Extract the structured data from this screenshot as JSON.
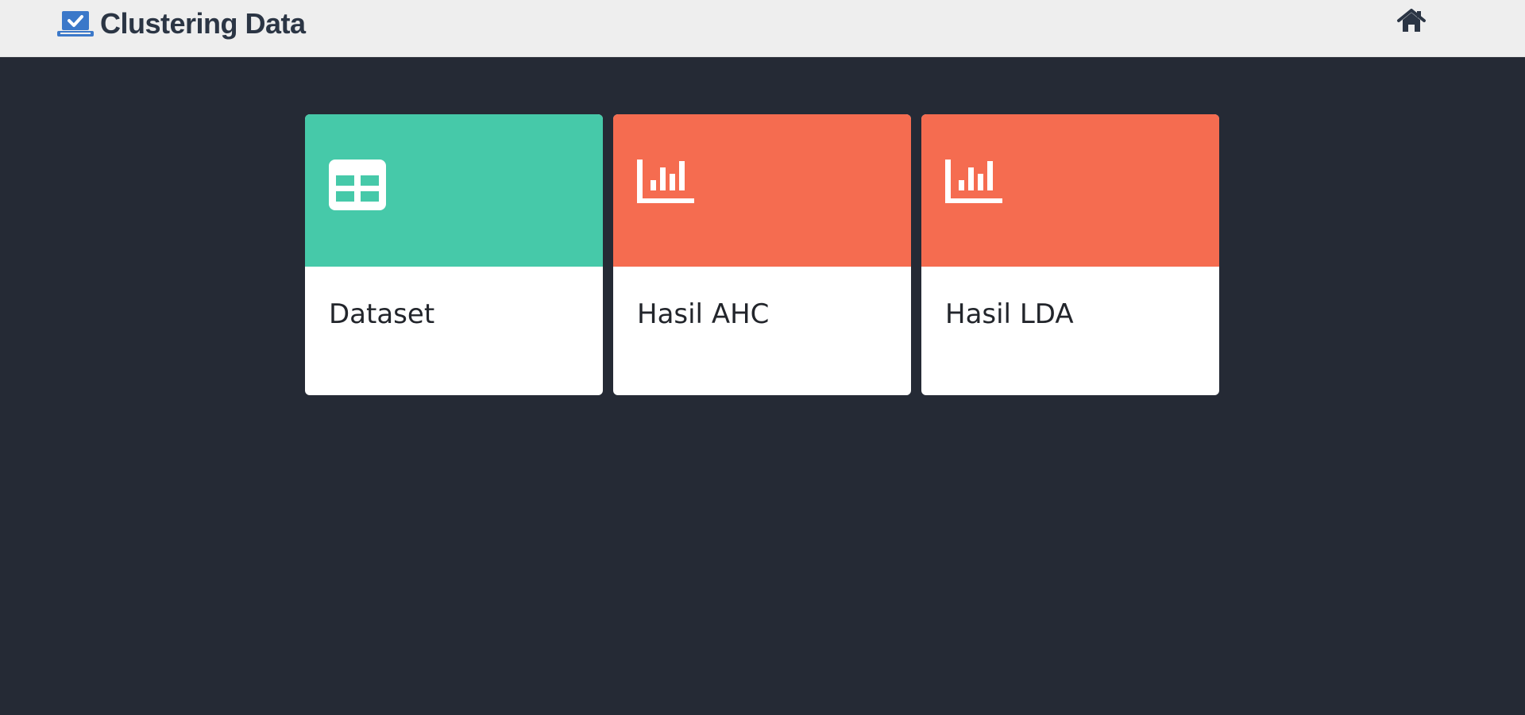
{
  "navbar": {
    "brand_title": "Clustering Data",
    "brand_icon": "laptop-check-icon",
    "home_icon": "home-icon"
  },
  "cards": [
    {
      "label": "Dataset",
      "icon": "table-icon",
      "color": "#46c9a9"
    },
    {
      "label": "Hasil AHC",
      "icon": "bar-chart-icon",
      "color": "#f56c50"
    },
    {
      "label": "Hasil LDA",
      "icon": "bar-chart-icon",
      "color": "#f56c50"
    }
  ],
  "colors": {
    "background": "#252a35",
    "navbar": "#eeeeee",
    "brand_text": "#2b3544",
    "brand_icon": "#3b78c9"
  }
}
